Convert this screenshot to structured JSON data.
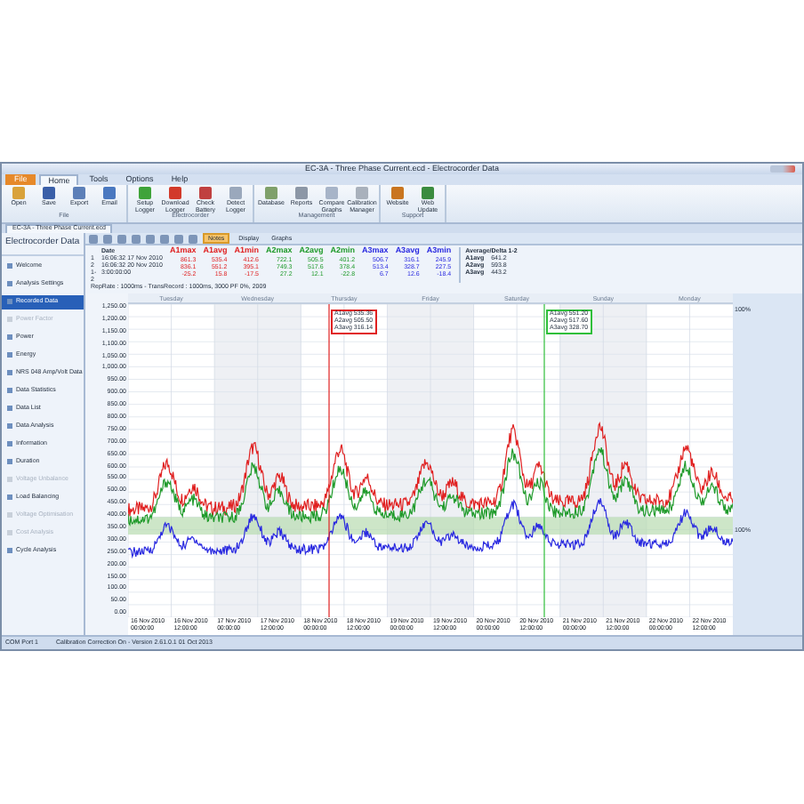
{
  "window": {
    "title": "EC-3A - Three Phase Current.ecd - Electrocorder Data"
  },
  "ribbon": {
    "tabs": [
      {
        "label": "File",
        "selected": false,
        "kind": "file"
      },
      {
        "label": "Home",
        "selected": true,
        "kind": "tab"
      },
      {
        "label": "Tools",
        "selected": false,
        "kind": "tab"
      },
      {
        "label": "Options",
        "selected": false,
        "kind": "tab"
      },
      {
        "label": "Help",
        "selected": false,
        "kind": "tab"
      }
    ],
    "groups": [
      {
        "label": "File",
        "buttons": [
          {
            "label": "Open",
            "color": "#d9a23a"
          },
          {
            "label": "Save",
            "color": "#3a5fa8"
          },
          {
            "label": "Export",
            "color": "#5c7fb8"
          },
          {
            "label": "Email",
            "color": "#4a78c0"
          }
        ]
      },
      {
        "label": "Electrocorder",
        "buttons": [
          {
            "label": "Setup Logger",
            "color": "#3fa33a"
          },
          {
            "label": "Download Logger",
            "color": "#d23a2a"
          },
          {
            "label": "Check Battery",
            "color": "#c04040"
          },
          {
            "label": "Detect Logger",
            "color": "#9aa8bc"
          }
        ]
      },
      {
        "label": "Management",
        "buttons": [
          {
            "label": "Database",
            "color": "#7fa06a"
          },
          {
            "label": "Reports",
            "color": "#8c97a6"
          },
          {
            "label": "Compare Graphs",
            "color": "#a7b4c8"
          },
          {
            "label": "Calibration Manager",
            "color": "#a9b1bc"
          }
        ]
      },
      {
        "label": "Support",
        "buttons": [
          {
            "label": "Website",
            "color": "#c9751f"
          },
          {
            "label": "Web Update",
            "color": "#3b8c3f"
          }
        ]
      }
    ]
  },
  "document_tab": {
    "label": "EC-3A - Three Phase Current.ecd"
  },
  "sidebar": {
    "title": "Electrocorder Data",
    "items": [
      {
        "label": "Welcome",
        "selected": false,
        "disabled": false
      },
      {
        "label": "Analysis Settings",
        "selected": false,
        "disabled": false
      },
      {
        "label": "Recorded Data",
        "selected": true,
        "disabled": false
      },
      {
        "label": "Power Factor",
        "selected": false,
        "disabled": true
      },
      {
        "label": "Power",
        "selected": false,
        "disabled": false
      },
      {
        "label": "Energy",
        "selected": false,
        "disabled": false
      },
      {
        "label": "NRS 048 Amp/Volt Data",
        "selected": false,
        "disabled": false
      },
      {
        "label": "Data Statistics",
        "selected": false,
        "disabled": false
      },
      {
        "label": "Data List",
        "selected": false,
        "disabled": false
      },
      {
        "label": "Data Analysis",
        "selected": false,
        "disabled": false
      },
      {
        "label": "Information",
        "selected": false,
        "disabled": false
      },
      {
        "label": "Duration",
        "selected": false,
        "disabled": false
      },
      {
        "label": "Voltage Unbalance",
        "selected": false,
        "disabled": true
      },
      {
        "label": "Load Balancing",
        "selected": false,
        "disabled": false
      },
      {
        "label": "Voltage Optimisation",
        "selected": false,
        "disabled": true
      },
      {
        "label": "Cost Analysis",
        "selected": false,
        "disabled": true
      },
      {
        "label": "Cycle Analysis",
        "selected": false,
        "disabled": false
      }
    ]
  },
  "toolbar": {
    "buttons": [
      {
        "label": "Notes",
        "selected": true
      },
      {
        "label": "Display",
        "selected": false
      },
      {
        "label": "Graphs",
        "selected": false
      }
    ]
  },
  "readings": {
    "date_label": "Date",
    "row_labels": [
      "1",
      "2",
      "1-2"
    ],
    "dates": [
      "16:06:32  17 Nov 2010",
      "16:06:32  20 Nov 2010",
      "3:00:00:00"
    ],
    "columns": [
      {
        "label": "A1max",
        "color": "#e02020",
        "values": [
          "861.3",
          "836.1",
          "-25.2"
        ]
      },
      {
        "label": "A1avg",
        "color": "#e02020",
        "values": [
          "535.4",
          "551.2",
          "15.8"
        ]
      },
      {
        "label": "A1min",
        "color": "#e02020",
        "values": [
          "412.6",
          "395.1",
          "-17.5"
        ]
      },
      {
        "label": "A2max",
        "color": "#1f9a2a",
        "values": [
          "722.1",
          "749.3",
          "27.2"
        ]
      },
      {
        "label": "A2avg",
        "color": "#1f9a2a",
        "values": [
          "505.5",
          "517.6",
          "12.1"
        ]
      },
      {
        "label": "A2min",
        "color": "#1f9a2a",
        "values": [
          "401.2",
          "378.4",
          "-22.8"
        ]
      },
      {
        "label": "A3max",
        "color": "#2828e0",
        "values": [
          "506.7",
          "513.4",
          "6.7"
        ]
      },
      {
        "label": "A3avg",
        "color": "#2828e0",
        "values": [
          "316.1",
          "328.7",
          "12.6"
        ]
      },
      {
        "label": "A3min",
        "color": "#2828e0",
        "values": [
          "245.9",
          "227.5",
          "-18.4"
        ]
      }
    ],
    "average": {
      "title": "Average/Delta 1-2",
      "rows": [
        {
          "label": "A1avg",
          "value": "641.2"
        },
        {
          "label": "A2avg",
          "value": "593.8"
        },
        {
          "label": "A3avg",
          "value": "443.2"
        }
      ]
    },
    "footer": "RepRate : 1000ms - TransRecord : 1000ms, 3000 PF 0%, 2009"
  },
  "chart": {
    "days": [
      "Tuesday",
      "Wednesday",
      "Thursday",
      "Friday",
      "Saturday",
      "Sunday",
      "Monday"
    ],
    "y_labels": [
      "1,250.00",
      "1,200.00",
      "1,150.00",
      "1,100.00",
      "1,050.00",
      "1,000.00",
      "950.00",
      "900.00",
      "850.00",
      "800.00",
      "750.00",
      "700.00",
      "650.00",
      "600.00",
      "550.00",
      "500.00",
      "450.00",
      "400.00",
      "350.00",
      "300.00",
      "250.00",
      "200.00",
      "150.00",
      "100.00",
      "50.00",
      "0.00"
    ],
    "x_labels": [
      "16 Nov 2010\n00:00:00",
      "16 Nov 2010\n12:00:00",
      "17 Nov 2010\n00:00:00",
      "17 Nov 2010\n12:00:00",
      "18 Nov 2010\n00:00:00",
      "18 Nov 2010\n12:00:00",
      "19 Nov 2010\n00:00:00",
      "19 Nov 2010\n12:00:00",
      "20 Nov 2010\n00:00:00",
      "20 Nov 2010\n12:00:00",
      "21 Nov 2010\n00:00:00",
      "21 Nov 2010\n12:00:00",
      "22 Nov 2010\n00:00:00",
      "22 Nov 2010\n12:00:00"
    ],
    "traces": [
      {
        "color": "#e02020"
      },
      {
        "color": "#1f9a2a"
      },
      {
        "color": "#2828e0"
      }
    ],
    "cursors": [
      {
        "color": "#e02020",
        "lines": [
          "A1avg 535.36",
          "A2avg 505.50",
          "A3avg 316.14"
        ]
      },
      {
        "color": "#2fbf3a",
        "lines": [
          "A1avg 551.20",
          "A2avg 517.60",
          "A3avg 328.70"
        ]
      }
    ],
    "scale_labels": [
      "100%",
      "100%"
    ]
  },
  "status_bar": {
    "items": [
      "COM Port 1",
      "Calibration Correction On - Version 2.61.0.1 01 Oct 2013"
    ]
  }
}
